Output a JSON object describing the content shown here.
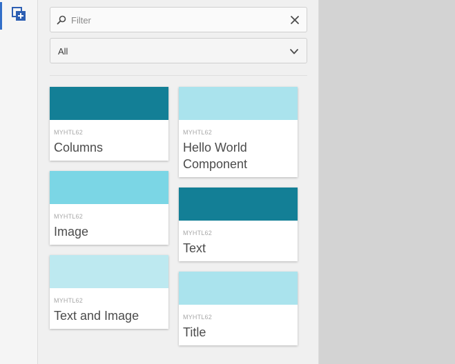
{
  "rail": {
    "active_icon": "add-component-icon"
  },
  "filter": {
    "placeholder": "Filter",
    "value": ""
  },
  "select": {
    "selected": "All"
  },
  "colors": {
    "dark_teal": "#137f96",
    "light_teal": "#aae3ed",
    "mid_teal": "#7bd6e5",
    "pale_teal": "#bde9f0",
    "accent": "#326ec8"
  },
  "components": {
    "left": [
      {
        "group": "MYHTL62",
        "title": "Columns",
        "color": "#137f96"
      },
      {
        "group": "MYHTL62",
        "title": "Image",
        "color": "#7bd6e5"
      },
      {
        "group": "MYHTL62",
        "title": "Text and Image",
        "color": "#bde9f0"
      }
    ],
    "right": [
      {
        "group": "MYHTL62",
        "title": "Hello World Component",
        "color": "#aae3ed"
      },
      {
        "group": "MYHTL62",
        "title": "Text",
        "color": "#137f96"
      },
      {
        "group": "MYHTL62",
        "title": "Title",
        "color": "#aae3ed"
      }
    ]
  }
}
